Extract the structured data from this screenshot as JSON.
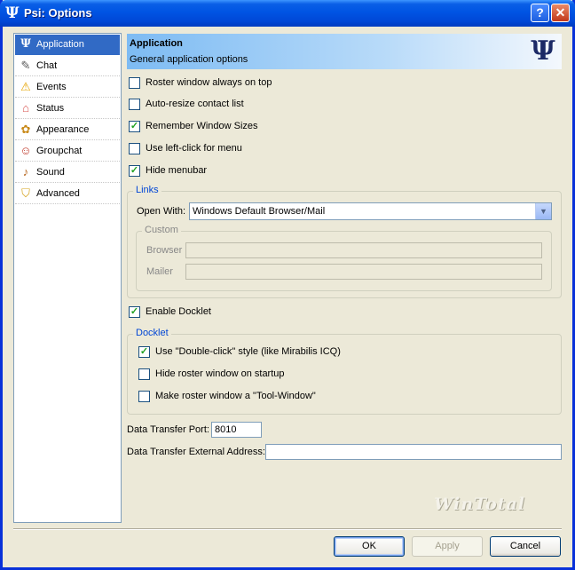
{
  "window": {
    "title": "Psi: Options"
  },
  "sidebar": {
    "items": [
      {
        "label": "Application",
        "icon": "psi-icon"
      },
      {
        "label": "Chat",
        "icon": "chat-icon"
      },
      {
        "label": "Events",
        "icon": "warning-icon"
      },
      {
        "label": "Status",
        "icon": "status-icon"
      },
      {
        "label": "Appearance",
        "icon": "palette-icon"
      },
      {
        "label": "Groupchat",
        "icon": "groupchat-icon"
      },
      {
        "label": "Sound",
        "icon": "bell-icon"
      },
      {
        "label": "Advanced",
        "icon": "shield-icon"
      }
    ]
  },
  "header": {
    "title": "Application",
    "subtitle": "General application options"
  },
  "options": [
    {
      "label": "Roster window always on top",
      "checked": false
    },
    {
      "label": "Auto-resize contact list",
      "checked": false
    },
    {
      "label": "Remember Window Sizes",
      "checked": true
    },
    {
      "label": "Use left-click for menu",
      "checked": false
    },
    {
      "label": "Hide menubar",
      "checked": true
    }
  ],
  "links": {
    "group_title": "Links",
    "open_with_label": "Open With:",
    "open_with_value": "Windows Default Browser/Mail",
    "custom": {
      "title": "Custom",
      "browser_label": "Browser",
      "mailer_label": "Mailer"
    }
  },
  "enable_docklet": {
    "label": "Enable Docklet",
    "checked": true
  },
  "docklet": {
    "group_title": "Docklet",
    "options": [
      {
        "label": "Use \"Double-click\" style (like Mirabilis ICQ)",
        "checked": true
      },
      {
        "label": "Hide roster window on startup",
        "checked": false
      },
      {
        "label": "Make roster window a \"Tool-Window\"",
        "checked": false
      }
    ]
  },
  "transfer": {
    "port_label": "Data Transfer Port:",
    "port_value": "8010",
    "external_label": "Data Transfer External Address:",
    "external_value": ""
  },
  "watermark": "WinTotal",
  "buttons": {
    "ok": "OK",
    "apply": "Apply",
    "cancel": "Cancel"
  },
  "colors": {
    "selection": "#316ac5",
    "titlebar": "#0054e3",
    "group_title": "#0046d5"
  }
}
